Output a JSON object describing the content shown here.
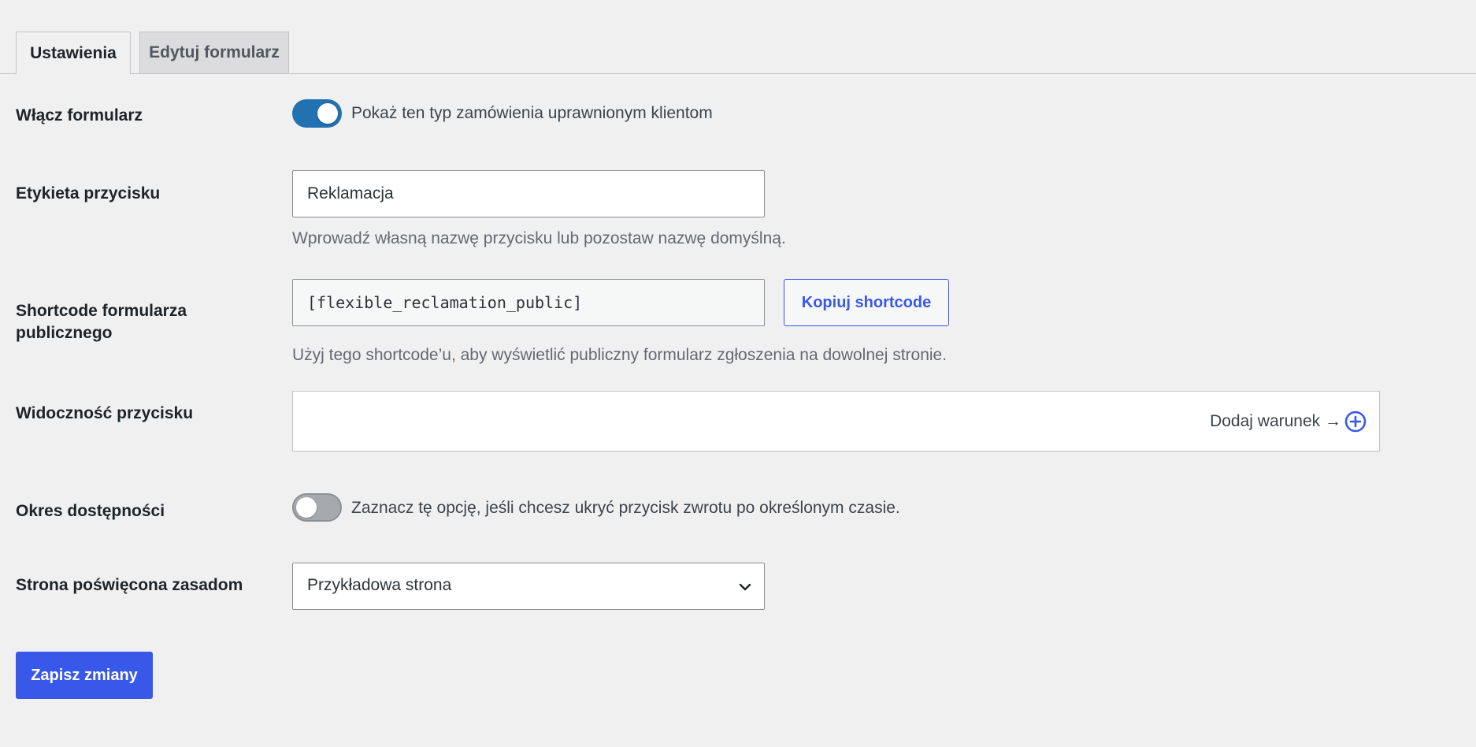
{
  "tabs": [
    {
      "label": "Ustawienia",
      "active": true
    },
    {
      "label": "Edytuj formularz",
      "active": false
    }
  ],
  "enable_form": {
    "label": "Włącz formularz",
    "toggle_on": true,
    "description": "Pokaż ten typ zamówienia uprawnionym klientom"
  },
  "button_label": {
    "label": "Etykieta przycisku",
    "value": "Reklamacja",
    "help": "Wprowadź własną nazwę przycisku lub pozostaw nazwę domyślną."
  },
  "shortcode": {
    "label_line1": "Shortcode formularza",
    "label_line2": "publicznego",
    "value": "[flexible_reclamation_public]",
    "copy_label": "Kopiuj shortcode",
    "help": "Użyj tego shortcode’u, aby wyświetlić publiczny formularz zgłoszenia na dowolnej stronie."
  },
  "visibility": {
    "label": "Widoczność przycisku",
    "add_condition": "Dodaj warunek →",
    "icon": "plus-circle-icon"
  },
  "availability": {
    "label": "Okres dostępności",
    "toggle_on": false,
    "description": "Zaznacz tę opcję, jeśli chcesz ukryć przycisk zwrotu po określonym czasie."
  },
  "policy_page": {
    "label": "Strona poświęcona zasadom",
    "selected": "Przykładowa strona",
    "icon": "chevron-down-icon"
  },
  "save_label": "Zapisz zmiany",
  "colors": {
    "accent": "#3858e9",
    "toggle_on": "#2271b1",
    "background": "#f0f0f1"
  }
}
